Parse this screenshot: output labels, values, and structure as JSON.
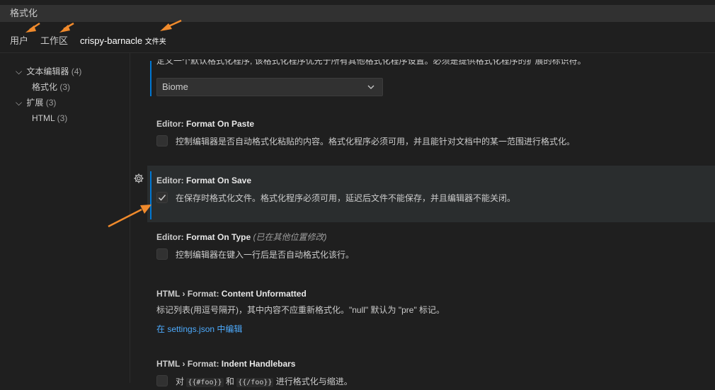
{
  "search": {
    "value": "格式化"
  },
  "scope_tabs": [
    {
      "label": "用户",
      "suffix": ""
    },
    {
      "label": "工作区",
      "suffix": ""
    },
    {
      "label": "crispy-barnacle",
      "suffix": "文件夹"
    }
  ],
  "toc": [
    {
      "label": "文本编辑器",
      "count": "(4)",
      "expanded": true
    },
    {
      "label": "格式化",
      "count": "(3)"
    },
    {
      "label": "扩展",
      "count": "(3)",
      "expanded": true
    },
    {
      "label": "HTML",
      "count": "(3)"
    }
  ],
  "settings": {
    "default_formatter": {
      "description_partial": "定义一个默认格式化程序, 该格式化程序优先于所有其他格式化程序设置。必须是提供格式化程序的扩展的标识符。",
      "value": "Biome"
    },
    "format_on_paste": {
      "category": "Editor: ",
      "name": "Format On Paste",
      "description": "控制编辑器是否自动格式化粘贴的内容。格式化程序必须可用，并且能针对文档中的某一范围进行格式化。",
      "checked": false
    },
    "format_on_save": {
      "category": "Editor: ",
      "name": "Format On Save",
      "description": "在保存时格式化文件。格式化程序必须可用，延迟后文件不能保存，并且编辑器不能关闭。",
      "checked": true
    },
    "format_on_type": {
      "category": "Editor: ",
      "name": "Format On Type",
      "modified_note": "(已在其他位置修改)",
      "description": "控制编辑器在键入一行后是否自动格式化该行。",
      "checked": false
    },
    "content_unformatted": {
      "category": "HTML › Format: ",
      "name": "Content Unformatted",
      "description": "标记列表(用逗号隔开)，其中内容不应重新格式化。\"null\" 默认为 \"pre\" 标记。",
      "link": "在 settings.json 中编辑"
    },
    "indent_handlebars": {
      "category": "HTML › Format: ",
      "name": "Indent Handlebars",
      "desc_prefix": "对",
      "code1": "{{#foo}}",
      "desc_mid": "和",
      "code2": "{{/foo}}",
      "desc_suffix": "进行格式化与缩进。",
      "checked": false
    }
  },
  "icons": {
    "gear": "gear-icon",
    "check": "check-icon",
    "chevron": "chevron-down-icon"
  },
  "colors": {
    "accent": "#0078d4",
    "link": "#4daafc",
    "annotation_arrow": "#f08a2c"
  }
}
